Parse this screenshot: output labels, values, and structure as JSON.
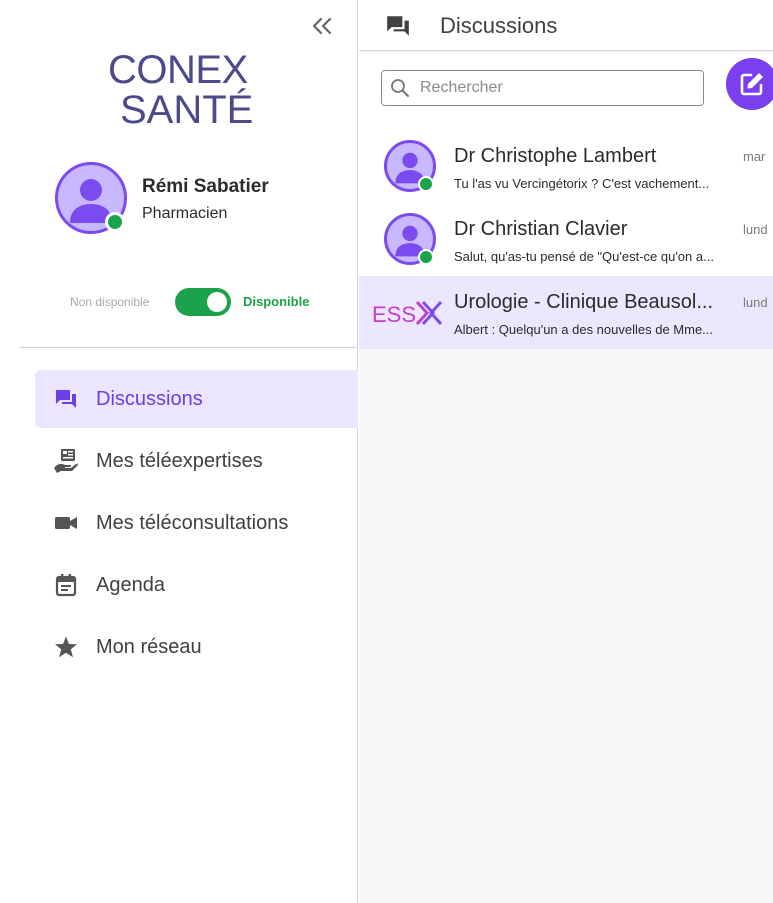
{
  "colors": {
    "accent": "#7b3ff0",
    "accent_text": "#6b3fe6",
    "active_bg": "#ebe5ff",
    "presence": "#1aa34a",
    "logo": "#4c4a8a",
    "group_logo": "#c040d0"
  },
  "sidebar": {
    "collapse_icon": "double-chevron-left-icon",
    "logo": {
      "line1": "CONE",
      "line1_mark": "X",
      "line2": "SANTÉ"
    },
    "profile": {
      "name": "Rémi Sabatier",
      "role": "Pharmacien",
      "status": "online"
    },
    "availability": {
      "off_label": "Non disponible",
      "on_label": "Disponible",
      "enabled": true
    },
    "nav": [
      {
        "label": "Discussions",
        "icon": "chat-bubbles-icon",
        "active": true
      },
      {
        "label": "Mes téléexpertises",
        "icon": "hand-document-icon",
        "active": false
      },
      {
        "label": "Mes téléconsultations",
        "icon": "video-camera-icon",
        "active": false
      },
      {
        "label": "Agenda",
        "icon": "calendar-icon",
        "active": false
      },
      {
        "label": "Mon réseau",
        "icon": "star-icon",
        "active": false
      }
    ]
  },
  "main": {
    "header": {
      "title": "Discussions",
      "icon": "chat-bubbles-icon"
    },
    "search": {
      "placeholder": "Rechercher",
      "value": "",
      "icon": "search-icon"
    },
    "compose_icon": "compose-icon",
    "conversations": [
      {
        "name": "Dr Christophe Lambert",
        "date": "mar",
        "preview": "Tu l'as vu Vercingétorix ? C'est vachement...",
        "type": "person",
        "online": true,
        "selected": false
      },
      {
        "name": "Dr Christian Clavier",
        "date": "lund",
        "preview": "Salut, qu'as-tu pensé de \"Qu'est-ce qu'on a...",
        "type": "person",
        "online": true,
        "selected": false
      },
      {
        "name": "Urologie - Clinique Beausol...",
        "date": "lund",
        "preview": "Albert : Quelqu'un a des nouvelles de Mme...",
        "type": "group",
        "group_logo_text": "ESS",
        "online": false,
        "selected": true
      }
    ]
  }
}
